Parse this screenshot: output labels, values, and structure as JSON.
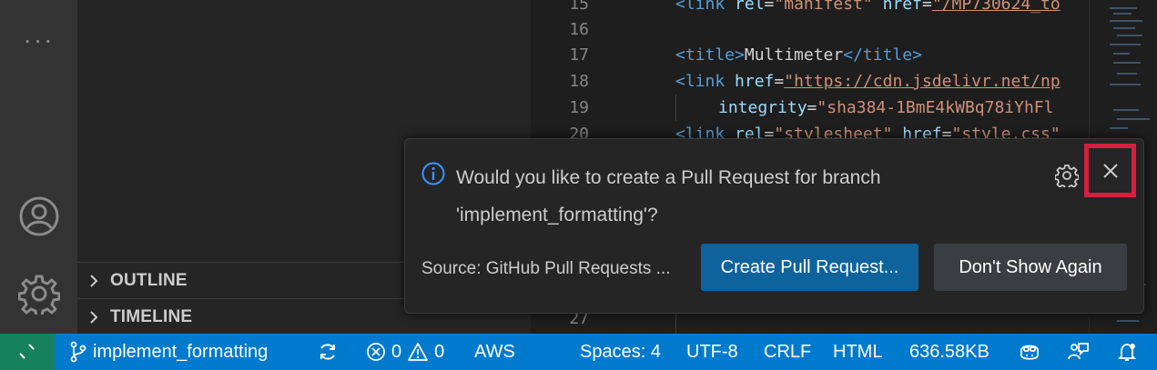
{
  "activity_bar": {
    "more_label": "···"
  },
  "sidebar": {
    "sections": [
      {
        "label": "OUTLINE"
      },
      {
        "label": "TIMELINE"
      }
    ]
  },
  "editor": {
    "lines": [
      {
        "number": "15"
      },
      {
        "number": "16"
      },
      {
        "number": "17"
      },
      {
        "number": "18"
      },
      {
        "number": "19"
      },
      {
        "number": "20"
      },
      {
        "number": "27"
      }
    ],
    "code": {
      "l15_tag": "<link",
      "l15_attr1": "rel",
      "l15_val1": "\"manifest\"",
      "l15_attr2": "href",
      "l15_val2": "\"/MP730624_to",
      "l17_open": "<title>",
      "l17_text": "Multimeter",
      "l17_close": "</title>",
      "l18_tag": "<link",
      "l18_attr": "href",
      "l18_val": "\"https://cdn.jsdelivr.net/np",
      "l19_attr": "integrity",
      "l19_val": "\"sha384-1BmE4kWBq78iYhFl",
      "l20_tag": "<link",
      "l20_attr1": "rel",
      "l20_val1": "\"stylesheet\"",
      "l20_attr2": "href",
      "l20_val2": "\"style.css\""
    }
  },
  "notification": {
    "message": "Would you like to create a Pull Request for branch 'implement_formatting'?",
    "source": "Source: GitHub Pull Requests ...",
    "primary_button": "Create Pull Request...",
    "secondary_button": "Don't Show Again"
  },
  "statusbar": {
    "branch": "implement_formatting",
    "errors": "0",
    "warnings": "0",
    "aws": "AWS",
    "spaces": "Spaces: 4",
    "encoding": "UTF-8",
    "eol": "CRLF",
    "language": "HTML",
    "size": "636.58KB"
  },
  "colors": {
    "statusbar": "#007acc",
    "remote": "#16825d",
    "primary_button": "#0e639c",
    "close_highlight": "#d61f3e",
    "info_icon": "#3794ff"
  }
}
